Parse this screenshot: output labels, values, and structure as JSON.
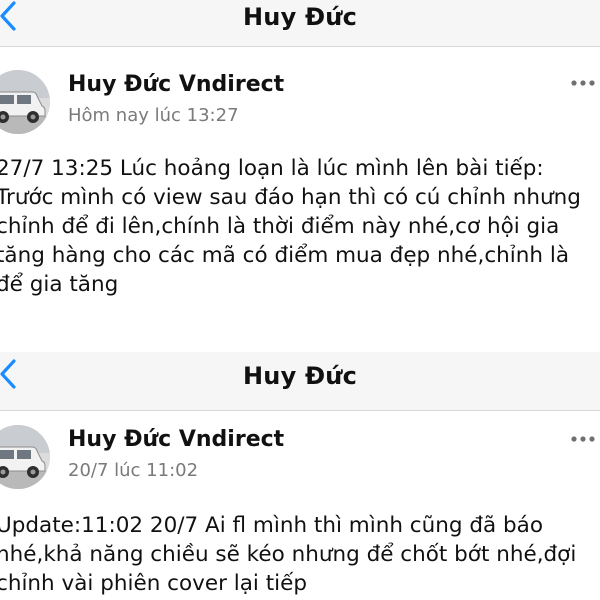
{
  "colors": {
    "accent": "#1a8cff",
    "header_bg": "#f6f6f6",
    "divider": "#d8d8d8",
    "meta_text": "#7a7a7a"
  },
  "icons": {
    "back": "chevron-left-icon",
    "more": "more-horizontal-icon"
  },
  "screens": [
    {
      "header_title": "Huy Đức",
      "post": {
        "author": "Huy Đức Vndirect",
        "timestamp": "Hôm nay lúc 13:27",
        "lines": [
          "27/7 13:25 Lúc hoảng loạn là lúc mình lên bài tiếp:",
          "Trước mình có view sau đáo hạn thì có cú chỉnh nhưng",
          "chỉnh để đi lên,chính là thời điểm này nhé,cơ hội gia",
          "tăng hàng cho các mã có điểm mua đẹp nhé,chỉnh là",
          "để gia tăng"
        ]
      }
    },
    {
      "header_title": "Huy Đức",
      "post": {
        "author": "Huy Đức Vndirect",
        "timestamp": "20/7 lúc 11:02",
        "lines": [
          "Update:11:02 20/7 Ai fl mình thì mình cũng đã báo",
          "nhé,khả năng chiều sẽ kéo nhưng để chốt bớt nhé,đợi",
          "chỉnh vài phiên cover lại tiếp"
        ]
      }
    }
  ]
}
